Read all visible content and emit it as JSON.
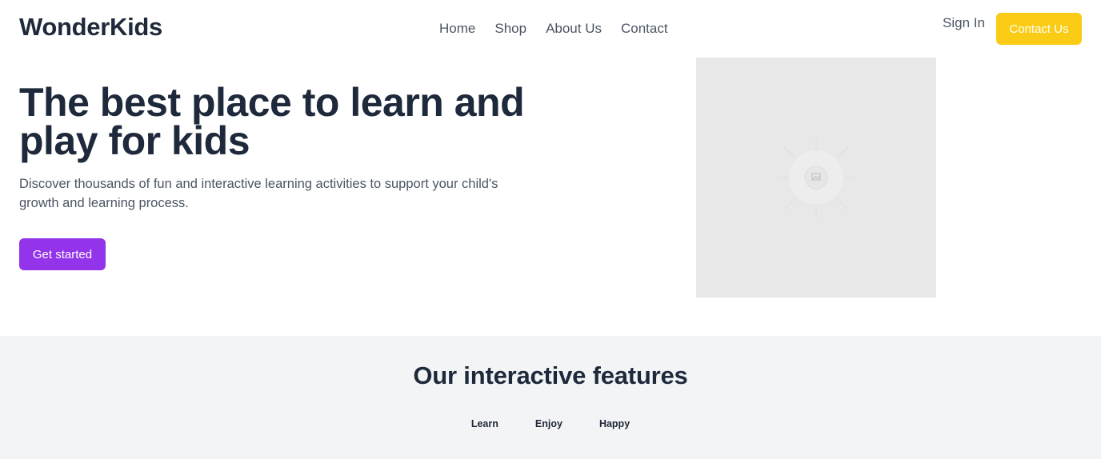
{
  "header": {
    "logo": "WonderKids",
    "nav": [
      "Home",
      "Shop",
      "About Us",
      "Contact"
    ],
    "sign_in": "Sign In",
    "contact_button": "Contact Us"
  },
  "hero": {
    "title": "The best place to learn and play for kids",
    "subtitle": "Discover thousands of fun and interactive learning activities to support your child's growth and learning process.",
    "cta_label": "Get started",
    "image_icon": "image-placeholder-icon"
  },
  "features": {
    "title": "Our interactive features",
    "tabs": [
      "Learn",
      "Enjoy",
      "Happy"
    ]
  },
  "colors": {
    "accent_yellow": "#facc15",
    "accent_purple": "#9333ea",
    "features_bg": "#f3f4f6",
    "image_bg": "#e8e8e8"
  }
}
